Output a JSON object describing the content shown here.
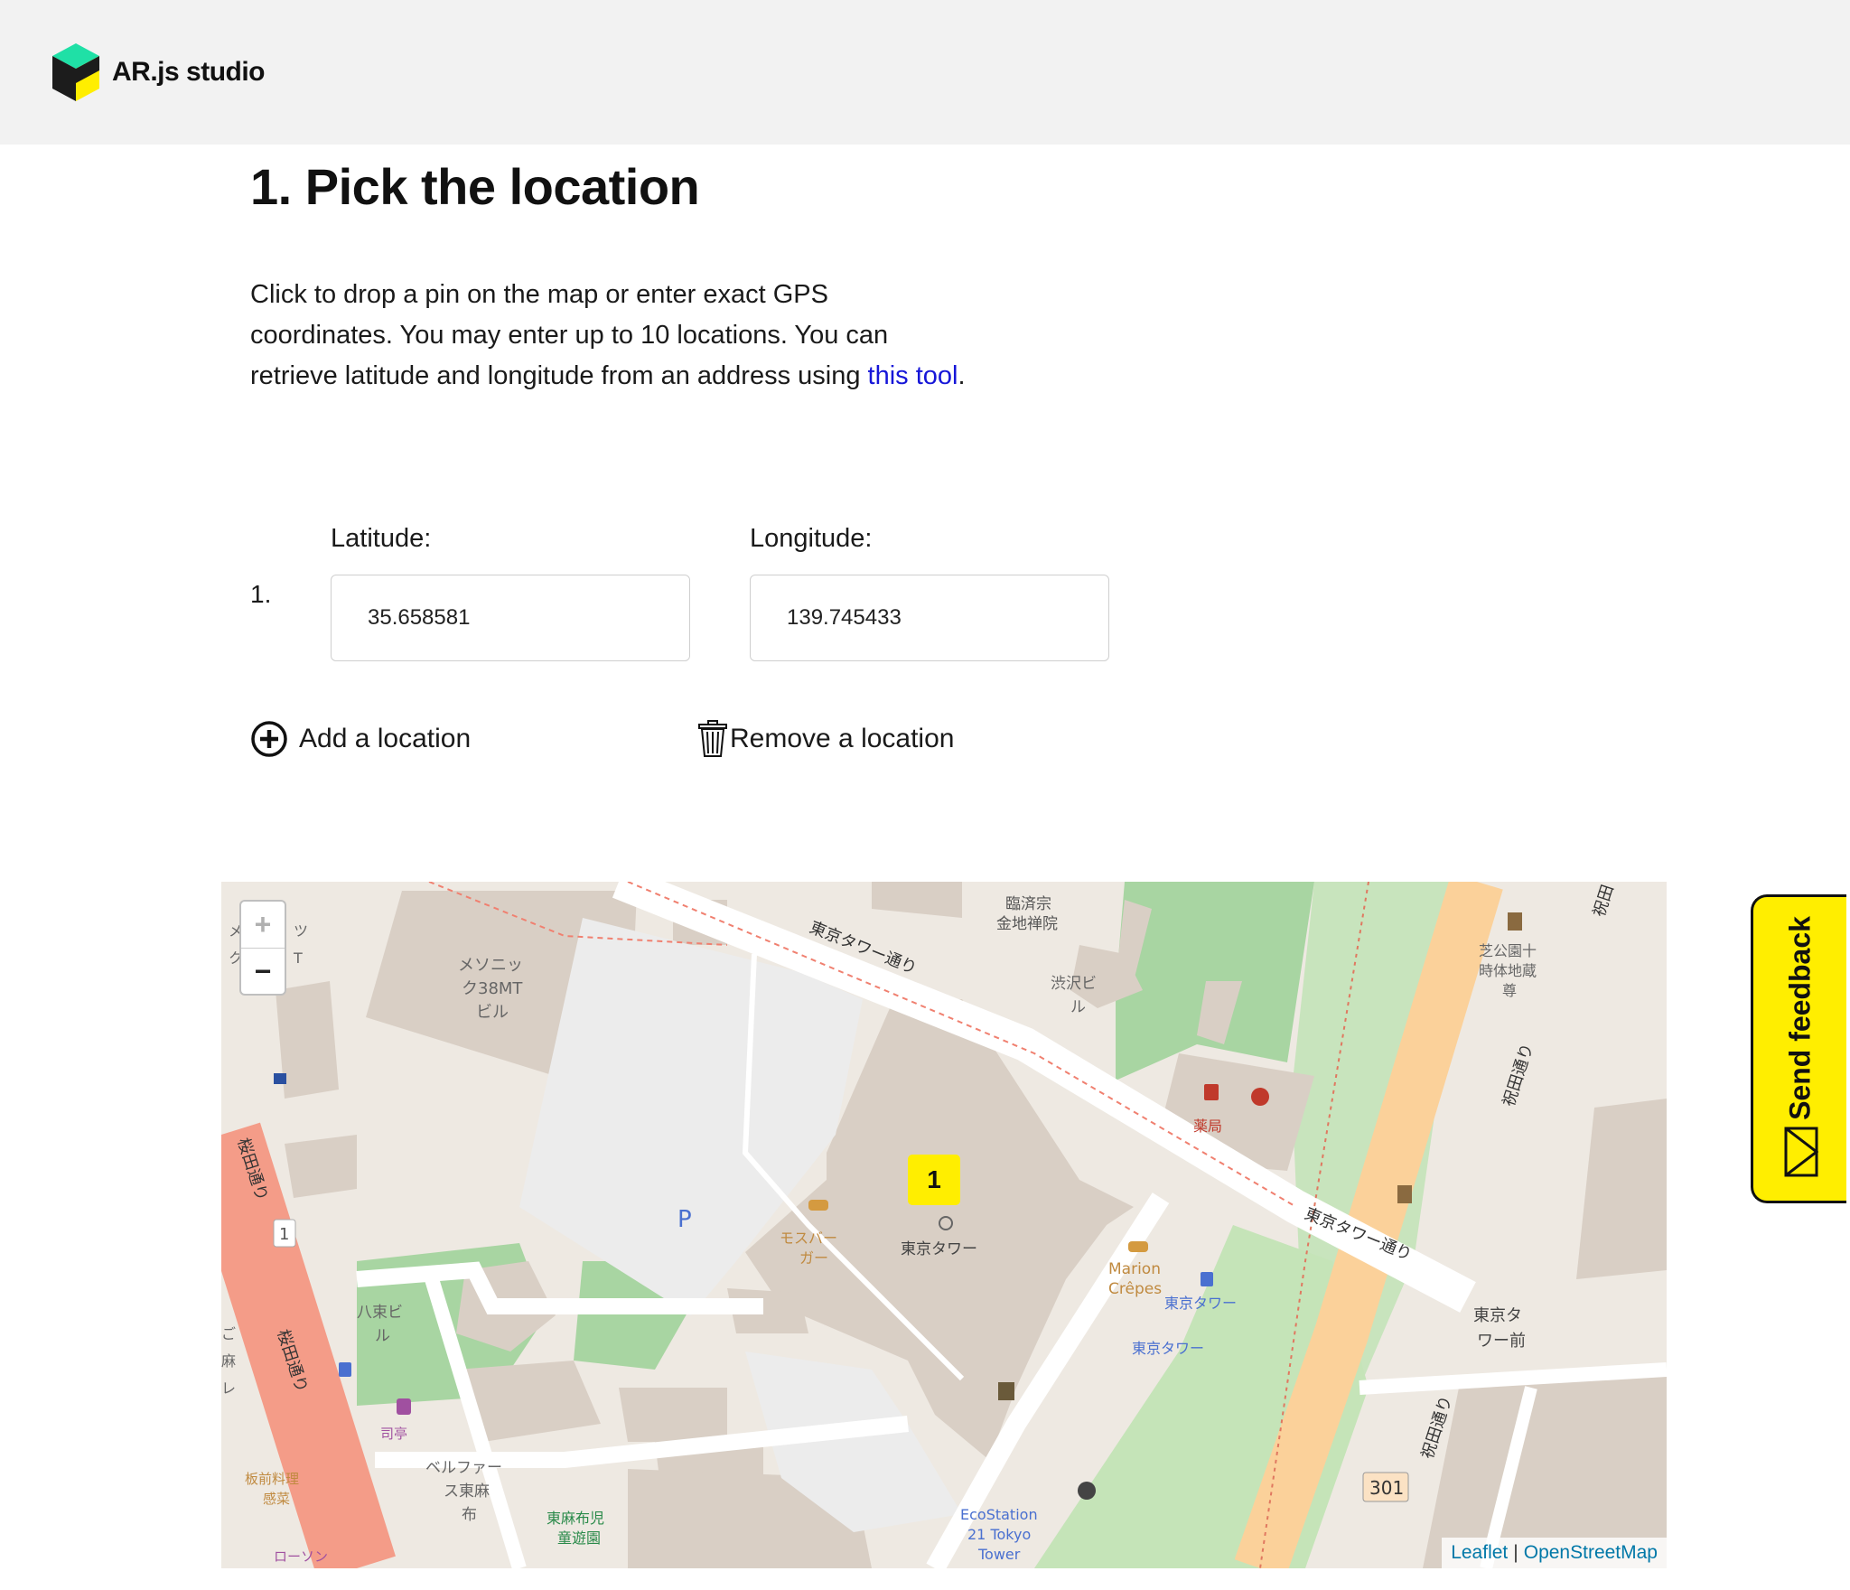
{
  "header": {
    "brand": "AR.js studio",
    "logo_colors": {
      "top": "#1fe0a6",
      "left": "#1c1c1c",
      "right": "#ffee00"
    }
  },
  "main": {
    "title": "1. Pick the location",
    "description": "Click to drop a pin on the map or enter exact GPS coordinates. You may enter up to 10 locations. You can retrieve latitude and longitude from an address using ",
    "link_text": "this tool",
    "description_end": "."
  },
  "locations": {
    "latitude_label": "Latitude:",
    "longitude_label": "Longitude:",
    "rows": [
      {
        "number": "1.",
        "latitude": "35.658581",
        "longitude": "139.745433"
      }
    ]
  },
  "actions": {
    "add": "Add a location",
    "remove": "Remove a location"
  },
  "map": {
    "zoom_in": "+",
    "zoom_out": "−",
    "marker_label": "1",
    "marker_color": "#ffee00",
    "attribution": {
      "leaflet": "Leaflet",
      "separator": "|",
      "osm": "OpenStreetMap"
    },
    "labels": {
      "tokyo_tower_street": "東京タワー通り",
      "rinzai": "臨済宗",
      "kinchi": "金地禅院",
      "shibusawa1": "渋沢ビ",
      "shibusawa2": "ル",
      "mesonic1": "メソニッ",
      "mesonic2": "ク38MT",
      "mesonic3": "ビル",
      "shibakoen1": "芝公園十",
      "shibakoen2": "時体地蔵",
      "shibakoen3": "尊",
      "yakkyoku": "薬局",
      "sakurada": "桜田通り",
      "sakurada2": "桜田通り",
      "hibiya": "祝田通り",
      "hibiya2": "祝田通り",
      "hibiya3": "祝田",
      "mos1": "モスバー",
      "mos2": "ガー",
      "tokyo_tower": "東京タワー",
      "marion1": "Marion",
      "marion2": "Crêpes",
      "bus1": "東京タワー",
      "bus2": "東京タワー",
      "tokyo_tower_mae1": "東京タ",
      "tokyo_tower_mae2": "ワー前",
      "hattsuka1": "八束ビ",
      "hattsuka2": "ル",
      "shitei": "司亭",
      "itamae1": "板前料理",
      "itamae2": "感菜",
      "lawson": "ローソン",
      "bellefa1": "ベルファー",
      "bellefa2": "ス東麻",
      "bellefa3": "布",
      "park1": "東麻布児",
      "park2": "童遊園",
      "eco1": "EcoStation",
      "eco2": "21 Tokyo",
      "eco3": "Tower",
      "route1": "1",
      "route301": "301",
      "parking": "P",
      "edge1": "メ",
      "edge2": "ツ",
      "edge3": "ク",
      "edge4": "T",
      "edge5": "ご",
      "edge6": "麻",
      "edge7": "レ"
    }
  },
  "feedback": {
    "label": "Send feedback"
  }
}
